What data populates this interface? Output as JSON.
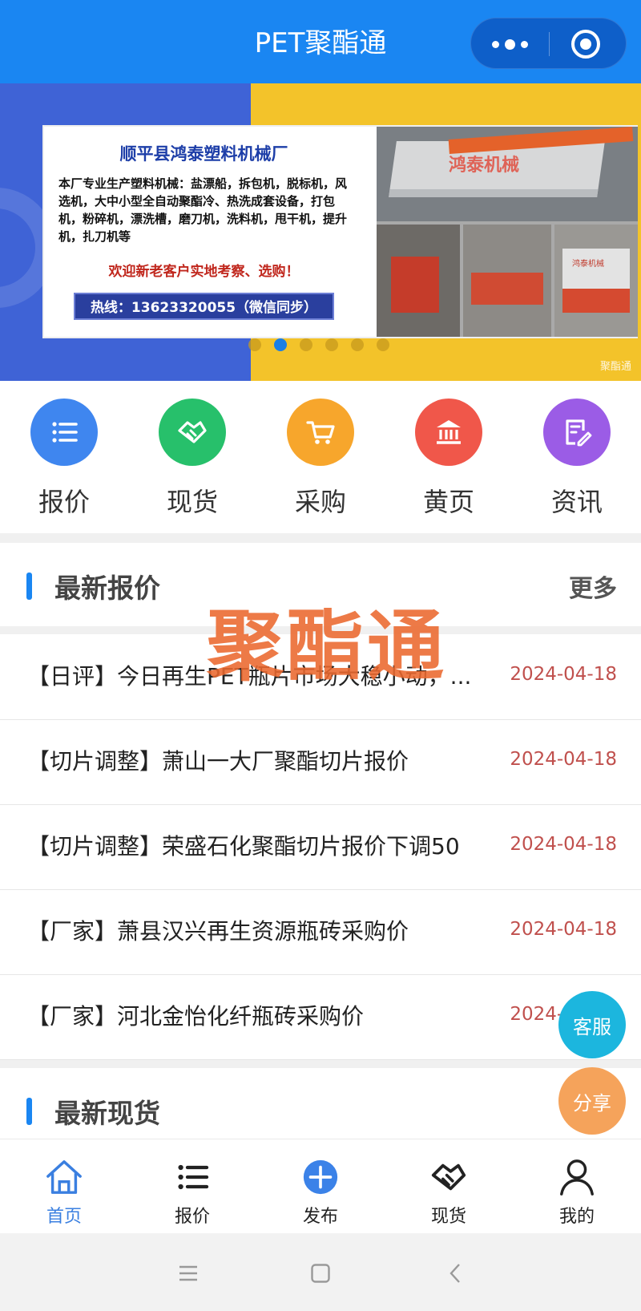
{
  "header": {
    "title": "PET聚酯通"
  },
  "banner": {
    "company": "顺平县鸿泰塑料机械厂",
    "description": "本厂专业生产塑料机械：盐漂船，拆包机，脱标机，风选机，大中小型全自动聚酯冷、热洗成套设备，打包机，粉碎机，漂洗槽，磨刀机，洗料机，甩干机，提升机，扎刀机等",
    "invite": "欢迎新老客户实地考察、选购！",
    "hotline": "热线：13623320055（微信同步）",
    "photo_brand": "鸿泰机械",
    "photo_small_label": "鸿泰机械",
    "corner_mark": "聚酯通",
    "indicator_count": 6,
    "active_index": 1
  },
  "nav": [
    {
      "label": "报价",
      "icon": "list-icon",
      "color": "#3f86ef"
    },
    {
      "label": "现货",
      "icon": "handshake-icon",
      "color": "#27c06b"
    },
    {
      "label": "采购",
      "icon": "cart-icon",
      "color": "#f7a62c"
    },
    {
      "label": "黄页",
      "icon": "bank-icon",
      "color": "#f0574a"
    },
    {
      "label": "资讯",
      "icon": "edit-note-icon",
      "color": "#9b5ce6"
    }
  ],
  "sections": {
    "quotes": {
      "title": "最新报价",
      "more": "更多"
    },
    "spot": {
      "title": "最新现货"
    }
  },
  "watermark": "聚酯通",
  "quotes": [
    {
      "title": "【日评】今日再生PET瓶片市场大稳小动，...",
      "date": "2024-04-18"
    },
    {
      "title": "【切片调整】萧山一大厂聚酯切片报价",
      "date": "2024-04-18"
    },
    {
      "title": "【切片调整】荣盛石化聚酯切片报价下调50",
      "date": "2024-04-18"
    },
    {
      "title": "【厂家】萧县汉兴再生资源瓶砖采购价",
      "date": "2024-04-18"
    },
    {
      "title": "【厂家】河北金怡化纤瓶砖采购价",
      "date": "2024-04-18"
    }
  ],
  "floating": {
    "service": {
      "label": "客服",
      "color": "#1cb6de"
    },
    "share": {
      "label": "分享",
      "color": "#f5a35b"
    }
  },
  "tabbar": [
    {
      "label": "首页",
      "icon": "home-icon",
      "active": true
    },
    {
      "label": "报价",
      "icon": "list-icon",
      "active": false
    },
    {
      "label": "发布",
      "icon": "plus-circle-icon",
      "active": false
    },
    {
      "label": "现货",
      "icon": "handshake-icon",
      "active": false
    },
    {
      "label": "我的",
      "icon": "user-icon",
      "active": false
    }
  ],
  "colors": {
    "primary": "#1a86f2",
    "date": "#c0504d",
    "banner_yellow": "#f3c32a",
    "banner_blue": "#3f63d6"
  }
}
